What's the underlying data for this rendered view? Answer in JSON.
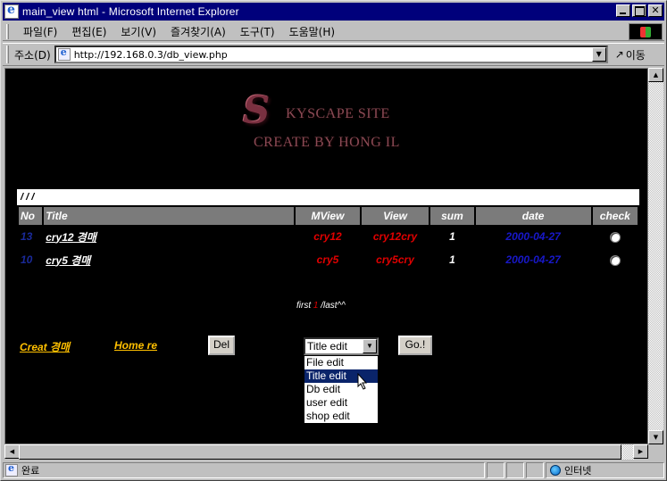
{
  "window": {
    "title": "main_view html - Microsoft Internet Explorer",
    "minimize": "_",
    "maximize": "□",
    "close": "✕"
  },
  "menu": {
    "items": [
      "파일(F)",
      "편집(E)",
      "보기(V)",
      "즐겨찾기(A)",
      "도구(T)",
      "도움말(H)"
    ]
  },
  "address": {
    "label": "주소(D)",
    "url": "http://192.168.0.3/db_view.php",
    "go_label": "이동"
  },
  "page": {
    "logo_s": "S",
    "logo_line1": "KYSCAPE SITE",
    "logo_line2": "CREATE BY HONG IL",
    "path": "/ / /",
    "columns": [
      "No",
      "Title",
      "MView",
      "View",
      "sum",
      "date",
      "check"
    ],
    "rows": [
      {
        "no": "13",
        "title": "cry12 경매",
        "mview": "cry12",
        "view": "cry12cry",
        "sum": "1",
        "date": "2000-04-27"
      },
      {
        "no": "10",
        "title": "cry5 경매",
        "mview": "cry5",
        "view": "cry5cry",
        "sum": "1",
        "date": "2000-04-27"
      }
    ],
    "pager": {
      "first": "first",
      "current": "1",
      "last": "/last^^"
    },
    "create_link": "Creat 경매",
    "home_link": "Home re",
    "del_button": "Del",
    "go_button": "Go.!",
    "select_value": "Title edit",
    "select_options": [
      "File edit",
      "Title edit",
      "Db edit",
      "user edit",
      "shop edit"
    ]
  },
  "status": {
    "text": "완료",
    "zone": "인터넷"
  },
  "colors": {
    "titlebar": "#00007b",
    "content_bg": "#000000",
    "header_gray": "#7b7b7b",
    "link_yellow": "#ffc000",
    "red": "#e00000",
    "blue": "#1818c8"
  }
}
